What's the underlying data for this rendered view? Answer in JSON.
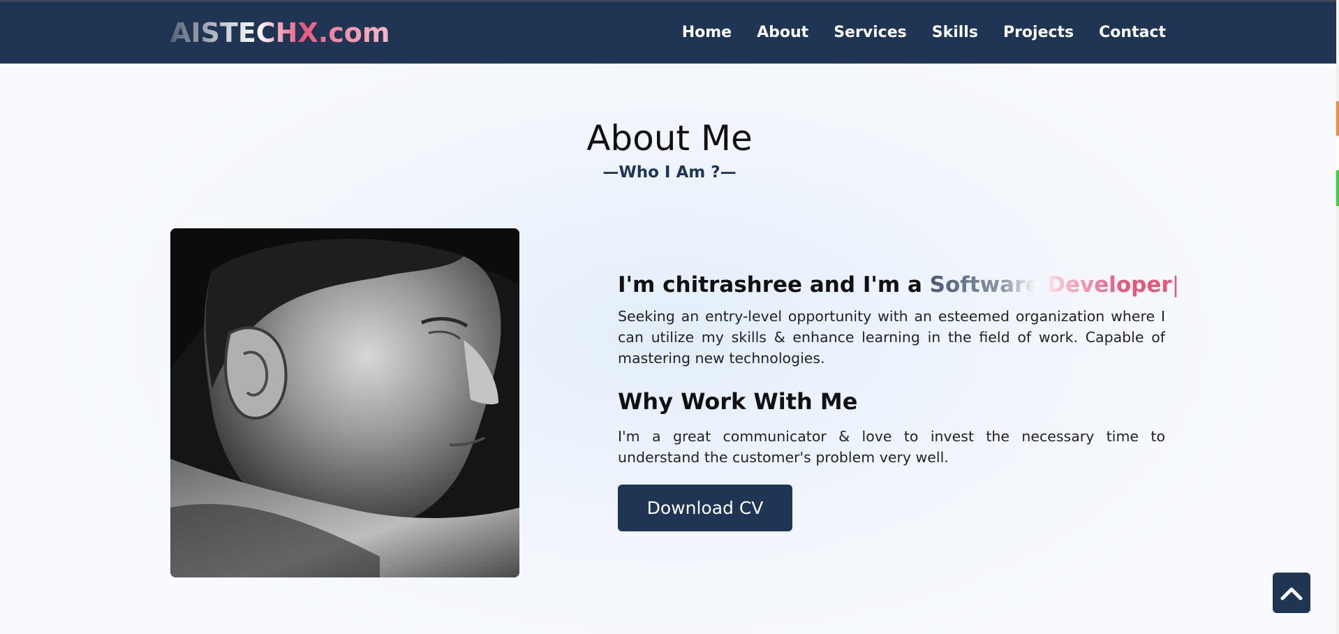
{
  "header": {
    "logo_text": "AISTECHX.com",
    "nav": [
      "Home",
      "About",
      "Services",
      "Skills",
      "Projects",
      "Contact"
    ]
  },
  "about": {
    "title": "About Me",
    "subtitle": "—Who I Am ?—",
    "intro_prefix": "I'm chitrashree and I'm a ",
    "typed_role": "Software Developer",
    "cursor": "|",
    "paragraph": "Seeking an entry-level opportunity with an esteemed organization where I can utilize my skills & enhance learning in the field of work. Capable of mastering new technologies.",
    "why_heading": "Why Work With Me",
    "why_paragraph": "I'm a great communicator & love to invest the necessary time to understand the customer's problem very well.",
    "cta_label": "Download CV"
  },
  "colors": {
    "navbar": "#1f3554",
    "accent_pink": "#e8567a",
    "button": "#1f3554"
  },
  "icons": {
    "scroll_top": "chevron-up-icon"
  }
}
